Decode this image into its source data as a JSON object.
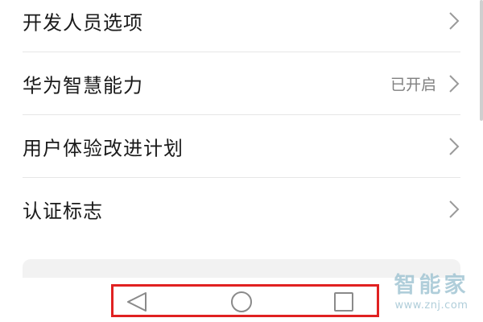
{
  "settings": {
    "items": [
      {
        "label": "开发人员选项",
        "value": ""
      },
      {
        "label": "华为智慧能力",
        "value": "已开启"
      },
      {
        "label": "用户体验改进计划",
        "value": ""
      },
      {
        "label": "认证标志",
        "value": ""
      }
    ]
  },
  "navbar": {
    "buttons": [
      {
        "name": "back",
        "icon": "back-triangle-icon"
      },
      {
        "name": "home",
        "icon": "home-circle-icon"
      },
      {
        "name": "recents",
        "icon": "recents-square-icon"
      }
    ],
    "highlight_color": "#e02121"
  },
  "watermark": {
    "title": "智能家",
    "url": "www.znj.com"
  }
}
